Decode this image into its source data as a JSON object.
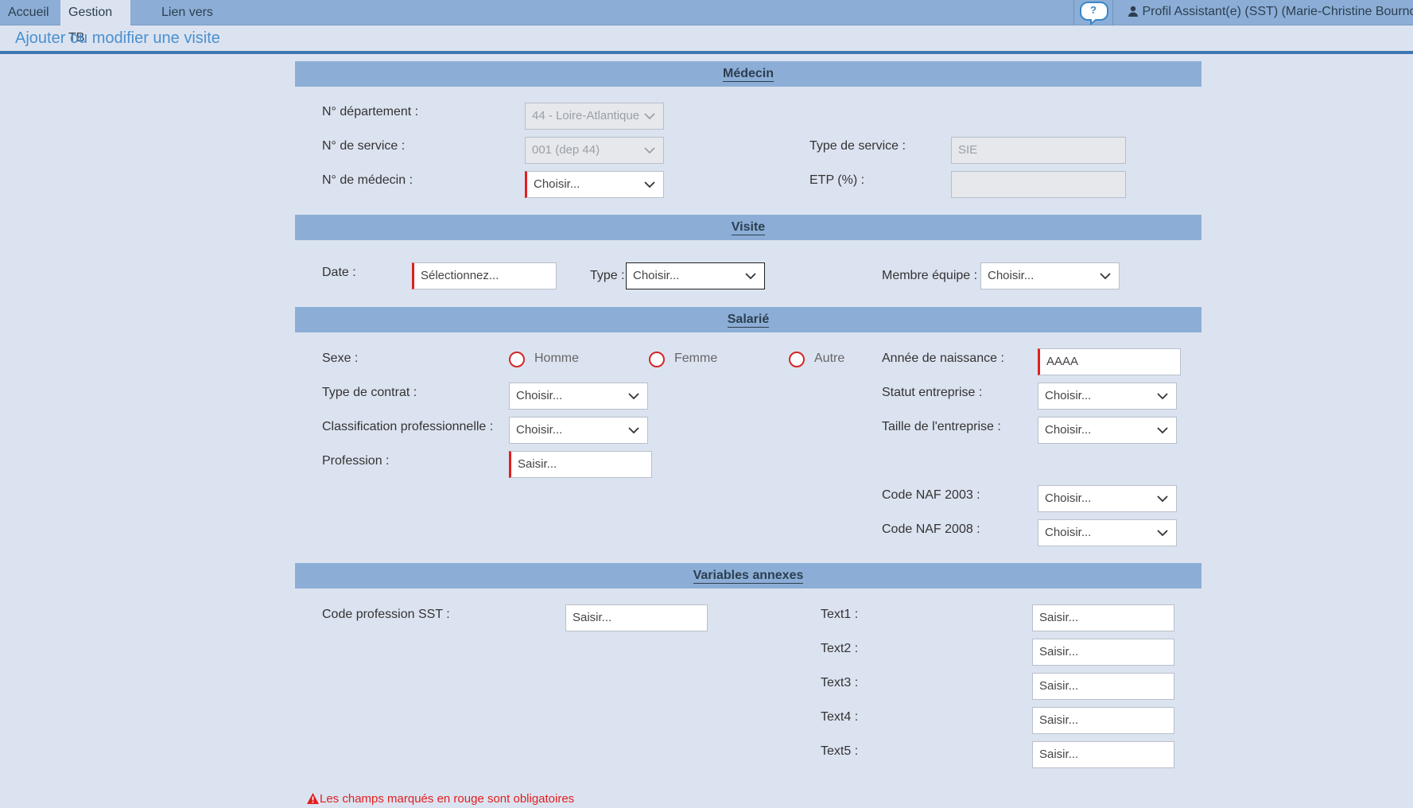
{
  "nav": {
    "tabs": [
      "Accueil",
      "Gestion TB",
      "Lien vers"
    ],
    "profile": "Profil Assistant(e) (SST) (Marie-Christine Bournot)"
  },
  "page": {
    "title": "Ajouter ou modifier une visite"
  },
  "medecin": {
    "section": "Médecin",
    "departement_label": "N° département :",
    "departement_value": "44 - Loire-Atlantique",
    "service_label": "N° de service :",
    "service_value": "001 (dep 44)",
    "type_service_label": "Type de service :",
    "type_service_value": "SIE",
    "medecin_label": "N° de médecin :",
    "medecin_value": "Choisir...",
    "etp_label": "ETP (%) :",
    "etp_value": ""
  },
  "visite": {
    "section": "Visite",
    "date_label": "Date :",
    "date_placeholder": "Sélectionnez...",
    "type_label": "Type :",
    "type_value": "Choisir...",
    "membre_label": "Membre équipe :",
    "membre_value": "Choisir..."
  },
  "salarie": {
    "section": "Salarié",
    "sexe_label": "Sexe :",
    "sexe_options": [
      "Homme",
      "Femme",
      "Autre"
    ],
    "annee_label": "Année de naissance :",
    "annee_placeholder": "AAAA",
    "contrat_label": "Type de contrat :",
    "contrat_value": "Choisir...",
    "statut_label": "Statut entreprise :",
    "statut_value": "Choisir...",
    "classif_label": "Classification professionnelle :",
    "classif_value": "Choisir...",
    "taille_label": "Taille de l'entreprise :",
    "taille_value": "Choisir...",
    "profession_label": "Profession :",
    "profession_placeholder": "Saisir...",
    "naf2003_label": "Code NAF 2003 :",
    "naf2003_value": "Choisir...",
    "naf2008_label": "Code NAF 2008 :",
    "naf2008_value": "Choisir..."
  },
  "annexes": {
    "section": "Variables annexes",
    "code_sst_label": "Code profession SST :",
    "code_sst_placeholder": "Saisir...",
    "texts": [
      {
        "label": "Text1 :",
        "placeholder": "Saisir..."
      },
      {
        "label": "Text2 :",
        "placeholder": "Saisir..."
      },
      {
        "label": "Text3 :",
        "placeholder": "Saisir..."
      },
      {
        "label": "Text4 :",
        "placeholder": "Saisir..."
      },
      {
        "label": "Text5 :",
        "placeholder": "Saisir..."
      }
    ]
  },
  "footer": {
    "warning": "Les champs marqués en rouge sont obligatoires"
  },
  "colors": {
    "header": "#8caed6",
    "background": "#dce3f0",
    "title": "#4a90d0",
    "required": "#e02020"
  }
}
